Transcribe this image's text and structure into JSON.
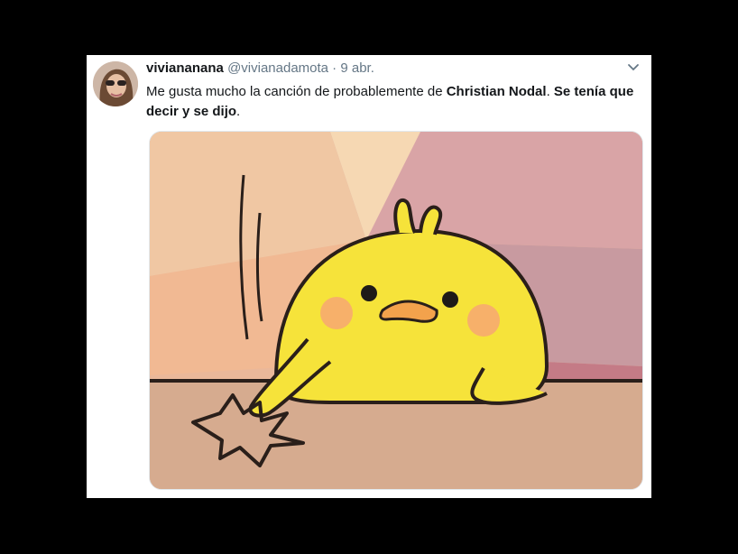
{
  "tweet": {
    "display_name": "vivianana­na",
    "handle": "@vivianadamota",
    "separator": " · ",
    "date": "9 abr.",
    "text_part1": "Me gusta mucho la canción de probablemente de ",
    "text_bold1": "Christian Nodal",
    "text_part2": ". ",
    "text_bold2": "Se tenía que decir y se dijo",
    "text_part3": "."
  },
  "icons": {
    "more": "chevron-down-icon",
    "avatar": "avatar"
  },
  "media": {
    "description_icon": "chick-meme-image"
  },
  "colors": {
    "background": "#000000",
    "card": "#ffffff",
    "text": "#14171a",
    "muted": "#657786",
    "chick": "#f6e33a"
  }
}
